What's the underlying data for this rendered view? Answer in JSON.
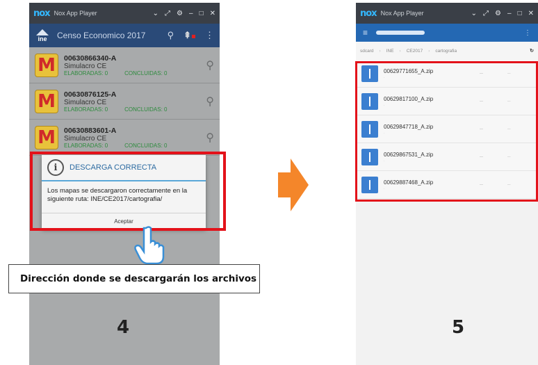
{
  "left_screen": {
    "window_title": "Nox App Player",
    "app_title": "Censo Economico 2017",
    "logo_text": "ine",
    "items": [
      {
        "code": "00630866340-A",
        "subtitle": "Simulacro CE",
        "elaboradas": "ELABORADAS: 0",
        "concluidas": "CONCLUIDAS: 0"
      },
      {
        "code": "00630876125-A",
        "subtitle": "Simulacro CE",
        "elaboradas": "ELABORADAS: 0",
        "concluidas": "CONCLUIDAS: 0"
      },
      {
        "code": "00630883601-A",
        "subtitle": "Simulacro CE",
        "elaboradas": "ELABORADAS: 0",
        "concluidas": "CONCLUIDAS: 0"
      }
    ],
    "dialog": {
      "title": "DESCARGA CORRECTA",
      "message": "Los mapas se descargaron correctamente en la siguiente ruta: INE/CE2017/cartografia/",
      "button": "Aceptar"
    }
  },
  "annotation": "Dirección donde se descargarán los archivos",
  "steps": {
    "left": "4",
    "right": "5"
  },
  "right_screen": {
    "window_title": "Nox App Player",
    "breadcrumbs": [
      "sdcard",
      "INE",
      "CE2017",
      "cartografia"
    ],
    "files": [
      {
        "name": "00629771655_A.zip"
      },
      {
        "name": "00629817100_A.zip"
      },
      {
        "name": "00629847718_A.zip"
      },
      {
        "name": "00629867531_A.zip"
      },
      {
        "name": "00629887468_A.zip"
      }
    ]
  },
  "colors": {
    "highlight": "#e3121a",
    "arrow": "#f4862a",
    "app_bar": "#2a4a78",
    "file_bar": "#2468b3"
  }
}
